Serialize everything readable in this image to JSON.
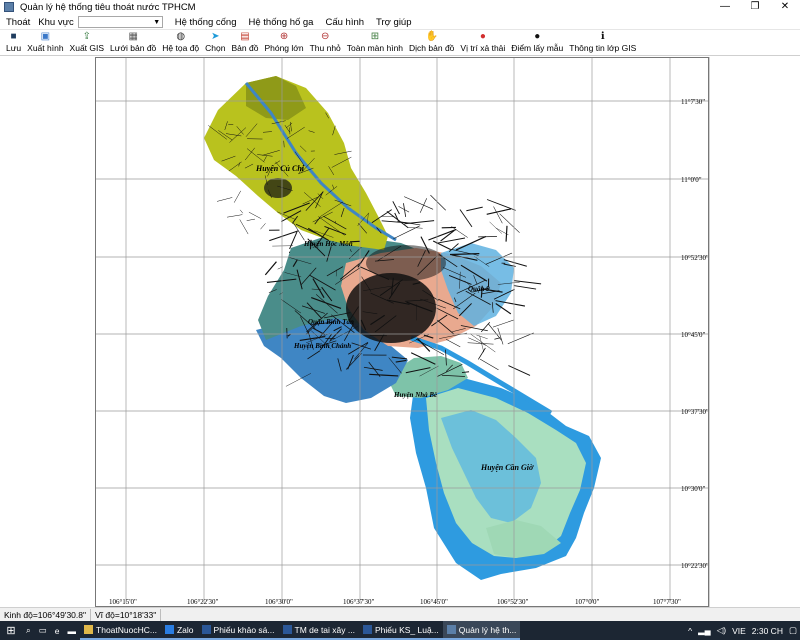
{
  "window": {
    "title": "Quản lý hệ thống tiêu thoát nước TPHCM",
    "controls": [
      "—",
      "❐",
      "✕"
    ]
  },
  "menu": {
    "items_left": [
      "Thoát",
      "Khu vực"
    ],
    "khu_vuc_value": "",
    "items_right": [
      "Hệ thống cống",
      "Hệ thống hố ga",
      "Cấu hình",
      "Trợ giúp"
    ]
  },
  "toolbar": [
    {
      "label": "Lưu",
      "icon": "save-icon",
      "glyph": "■",
      "color": "#1f3c5e"
    },
    {
      "label": "Xuất hình",
      "icon": "export-image-icon",
      "glyph": "▣",
      "color": "#3b79c9"
    },
    {
      "label": "Xuất GIS",
      "icon": "export-gis-icon",
      "glyph": "⇪",
      "color": "#3a7d44"
    },
    {
      "label": "Lưới bản đồ",
      "icon": "grid-icon",
      "glyph": "▦",
      "color": "#555555"
    },
    {
      "label": "Hệ tọa độ",
      "icon": "globe-icon",
      "glyph": "◍",
      "color": "#2d2d2d"
    },
    {
      "label": "Chọn",
      "icon": "pointer-icon",
      "glyph": "➤",
      "color": "#1f9bd9"
    },
    {
      "label": "Bản đồ",
      "icon": "layers-icon",
      "glyph": "▤",
      "color": "#c0392b"
    },
    {
      "label": "Phóng lớn",
      "icon": "zoom-in-icon",
      "glyph": "⊕",
      "color": "#b03030"
    },
    {
      "label": "Thu nhỏ",
      "icon": "zoom-out-icon",
      "glyph": "⊖",
      "color": "#b03030"
    },
    {
      "label": "Toàn màn hình",
      "icon": "full-extent-icon",
      "glyph": "⊞",
      "color": "#3b7a3b"
    },
    {
      "label": "Dịch bản đồ",
      "icon": "pan-icon",
      "glyph": "✋",
      "color": "#2a2a6a"
    },
    {
      "label": "Vị trí xả thải",
      "icon": "discharge-pin-icon",
      "glyph": "●",
      "color": "#d22f2f"
    },
    {
      "label": "Điểm lấy mẫu",
      "icon": "sample-pin-icon",
      "glyph": "●",
      "color": "#111111"
    },
    {
      "label": "Thông tin lớp GIS",
      "icon": "info-icon",
      "glyph": "ℹ",
      "color": "#111111"
    }
  ],
  "map": {
    "lat_labels": [
      "11°7'30\"",
      "11°0'0\"",
      "10°52'30\"",
      "10°45'0\"",
      "10°37'30\"",
      "10°30'0\"",
      "10°22'30\""
    ],
    "lon_labels": [
      "106°15'0\"",
      "106°22'30\"",
      "106°30'0\"",
      "106°37'30\"",
      "106°45'0\"",
      "106°52'30\"",
      "107°0'0\"",
      "107°7'30\""
    ],
    "district_labels": [
      "Huyện Củ Chi",
      "Huyện Hóc Môn",
      "Quận 9",
      "Quận Bình Tân",
      "Huyện Bình Chánh",
      "Huyện Nhà Bè",
      "Huyện Cần Giờ"
    ],
    "colors": {
      "cu_chi": "#b9c21e",
      "cu_chi_dark": "#8f9a18",
      "hoc_mon": "#4a8d8a",
      "binh_chanh": "#3f86c4",
      "urban": "#e9a98f",
      "nha_be": "#7ec3a9",
      "can_gio_water": "#2e9be0",
      "can_gio_land": "#a9dfc0",
      "roads": "#111111"
    }
  },
  "status": {
    "longitude": "Kinh độ=106°49'30.8\"",
    "latitude": "Vĩ độ=10°18'33\""
  },
  "taskbar": {
    "items": [
      {
        "label": "ThoatNuocHC...",
        "color": "#e0b84a"
      },
      {
        "label": "Zalo",
        "color": "#2a7de1"
      },
      {
        "label": "Phiếu khảo sá...",
        "color": "#2b5797"
      },
      {
        "label": "TM de tai xây ...",
        "color": "#2b5797"
      },
      {
        "label": "Phiếu KS_ Luậ...",
        "color": "#2b5797"
      },
      {
        "label": "Quản lý hệ th...",
        "color": "#5b7fa8"
      }
    ],
    "language": "VIE",
    "time": "2:30 CH"
  }
}
